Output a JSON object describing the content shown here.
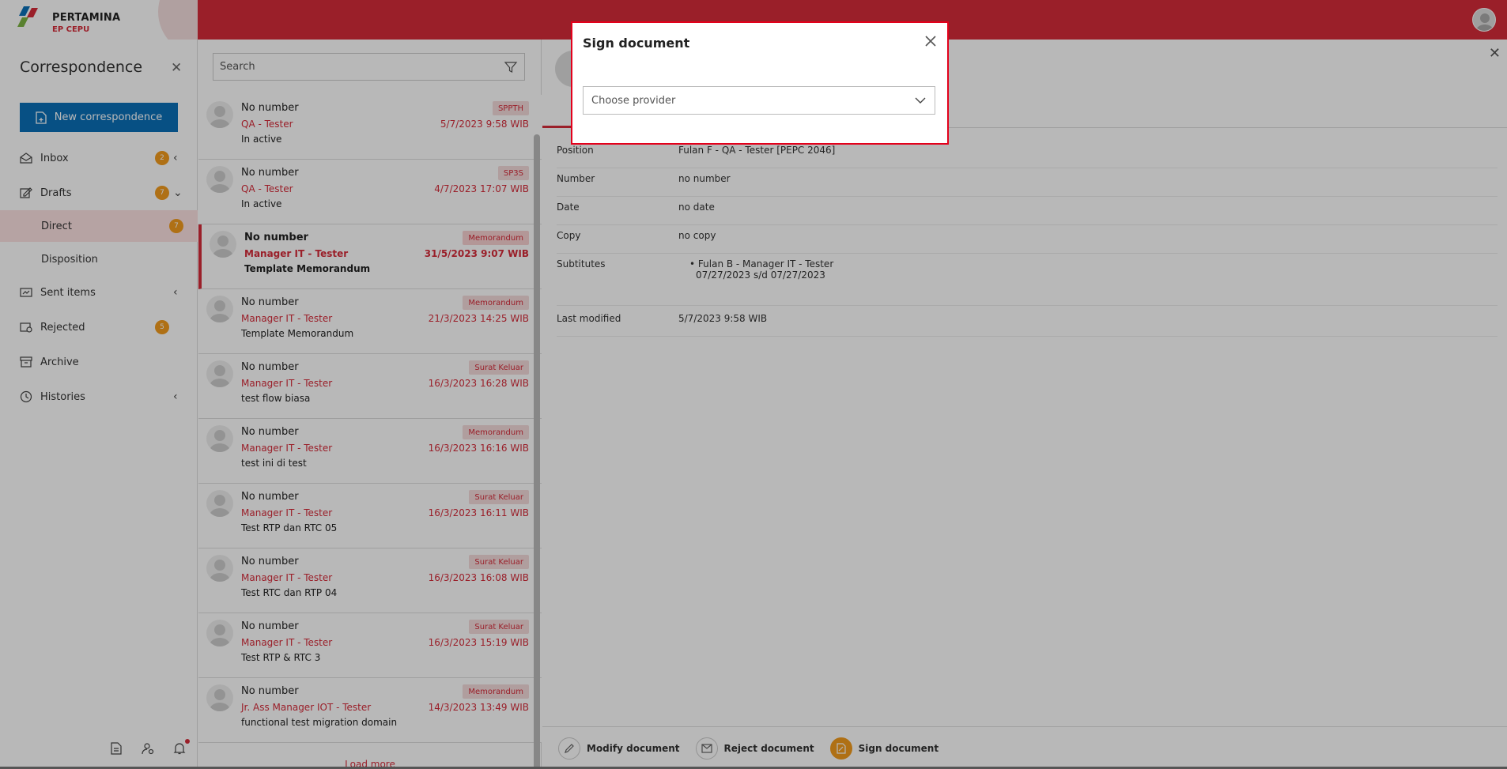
{
  "header": {
    "brand": "PERTAMINA",
    "sub_brand": "EP CEPU"
  },
  "sidebar": {
    "title": "Correspondence",
    "new_button": "New correspondence",
    "items": [
      {
        "label": "Inbox",
        "badge": "2"
      },
      {
        "label": "Drafts",
        "badge": "7"
      },
      {
        "label": "Direct",
        "badge": "7"
      },
      {
        "label": "Disposition"
      },
      {
        "label": "Sent items"
      },
      {
        "label": "Rejected",
        "badge": "5"
      },
      {
        "label": "Archive"
      },
      {
        "label": "Histories"
      }
    ]
  },
  "search": {
    "placeholder": "Search"
  },
  "list": [
    {
      "number": "No number",
      "from": "QA - Tester",
      "subject": "In active",
      "tag": "SPPTH",
      "date": "5/7/2023 9:58 WIB"
    },
    {
      "number": "No number",
      "from": "QA - Tester",
      "subject": "In active",
      "tag": "SP3S",
      "date": "4/7/2023 17:07 WIB"
    },
    {
      "number": "No number",
      "from": "Manager IT - Tester",
      "subject": "Template Memorandum",
      "tag": "Memorandum",
      "date": "31/5/2023 9:07 WIB"
    },
    {
      "number": "No number",
      "from": "Manager IT - Tester",
      "subject": "Template Memorandum",
      "tag": "Memorandum",
      "date": "21/3/2023 14:25 WIB"
    },
    {
      "number": "No number",
      "from": "Manager IT - Tester",
      "subject": "test flow biasa",
      "tag": "Surat Keluar",
      "date": "16/3/2023 16:28 WIB"
    },
    {
      "number": "No number",
      "from": "Manager IT - Tester",
      "subject": "test ini di test",
      "tag": "Memorandum",
      "date": "16/3/2023 16:16 WIB"
    },
    {
      "number": "No number",
      "from": "Manager IT - Tester",
      "subject": "Test RTP dan RTC 05",
      "tag": "Surat Keluar",
      "date": "16/3/2023 16:11 WIB"
    },
    {
      "number": "No number",
      "from": "Manager IT - Tester",
      "subject": "Test RTC dan RTP 04",
      "tag": "Surat Keluar",
      "date": "16/3/2023 16:08 WIB"
    },
    {
      "number": "No number",
      "from": "Manager IT - Tester",
      "subject": "Test RTP & RTC 3",
      "tag": "Surat Keluar",
      "date": "16/3/2023 15:19 WIB"
    },
    {
      "number": "No number",
      "from": "Jr. Ass Manager IOT - Tester",
      "subject": "functional test migration domain",
      "tag": "Memorandum",
      "date": "14/3/2023 13:49 WIB"
    }
  ],
  "load_more": "Load more",
  "detail": {
    "rows": [
      {
        "key": "Position",
        "value": "Fulan F - QA - Tester [PEPC 2046]"
      },
      {
        "key": "Number",
        "value": "no number"
      },
      {
        "key": "Date",
        "value": "no date"
      },
      {
        "key": "Copy",
        "value": "no copy"
      },
      {
        "key": "Subtitutes",
        "value": "Fulan B - Manager IT - Tester",
        "value2": "07/27/2023 s/d 07/27/2023"
      },
      {
        "key": "Last modified",
        "value": "5/7/2023 9:58 WIB"
      }
    ],
    "actions": {
      "modify": "Modify document",
      "reject": "Reject document",
      "sign": "Sign document"
    }
  },
  "modal": {
    "title": "Sign document",
    "select_placeholder": "Choose provider"
  },
  "colors": {
    "brand_red": "#d62b3a",
    "accent_blue": "#0b6fb8",
    "badge_orange": "#f39c1e",
    "modal_border": "#e3001b"
  }
}
